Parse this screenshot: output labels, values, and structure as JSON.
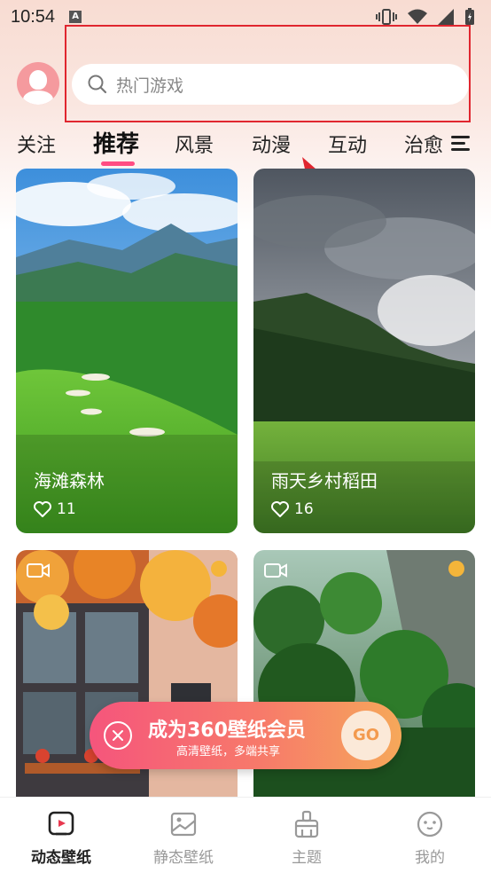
{
  "status_bar": {
    "time": "10:54",
    "badge": "A"
  },
  "search": {
    "placeholder": "热门游戏"
  },
  "tabs": [
    {
      "label": "关注"
    },
    {
      "label": "推荐"
    },
    {
      "label": "风景"
    },
    {
      "label": "动漫"
    },
    {
      "label": "互动"
    },
    {
      "label": "治愈"
    }
  ],
  "cards": [
    {
      "title": "海滩森林",
      "likes": "11"
    },
    {
      "title": "雨天乡村稻田",
      "likes": "16"
    },
    {
      "title": "",
      "likes": ""
    },
    {
      "title": "",
      "likes": ""
    }
  ],
  "member_banner": {
    "title": "成为360壁纸会员",
    "subtitle": "高清壁纸，多端共享",
    "go": "GO"
  },
  "bottom_nav": [
    {
      "label": "动态壁纸"
    },
    {
      "label": "静态壁纸"
    },
    {
      "label": "主题"
    },
    {
      "label": "我的"
    }
  ],
  "colors": {
    "accent": "#ff4d83",
    "annotation": "#e0262f"
  }
}
